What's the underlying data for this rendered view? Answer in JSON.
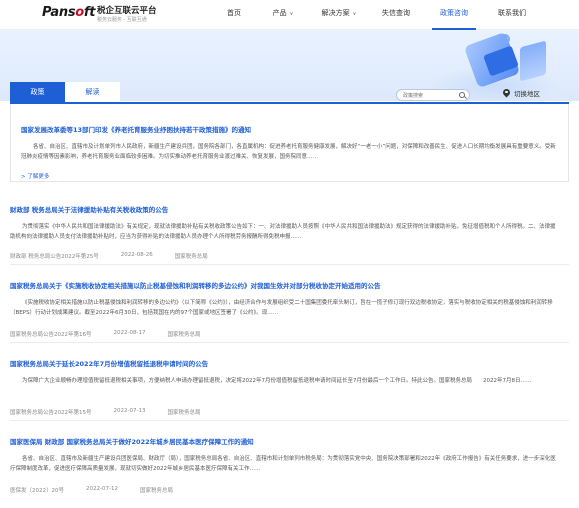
{
  "header": {
    "logo_text_a": "Pans",
    "logo_text_o": "o",
    "logo_text_b": "ft",
    "brand_title": "税企互联云平台",
    "brand_subtitle": "税务云服务 · 互联互通",
    "nav": [
      {
        "label": "首页",
        "has_chevron": false,
        "active": false
      },
      {
        "label": "产品",
        "has_chevron": true,
        "active": false
      },
      {
        "label": "解决方案",
        "has_chevron": true,
        "active": false
      },
      {
        "label": "失信查询",
        "has_chevron": false,
        "active": false
      },
      {
        "label": "政策咨询",
        "has_chevron": false,
        "active": true
      },
      {
        "label": "联系我们",
        "has_chevron": false,
        "active": false
      }
    ],
    "chevron": "∨"
  },
  "tabs": [
    {
      "label": "政策",
      "active": true
    },
    {
      "label": "解读",
      "active": false
    }
  ],
  "search": {
    "placeholder": "政策搜索"
  },
  "region": {
    "label": "切换地区"
  },
  "featured": {
    "title": "国家发展改革委等13部门印发《养老托育服务业纾困扶持若干政策措施》的通知",
    "body": "各省、自治区、直辖市及计划单列市人民政府，新疆生产建设兵团，国务院各部门，各直属机构：促进养老托育服务健康发展，解决好“一老一小”问题，对保障和改善民生、促进人口长期均衡发展具有重要意义。受新冠肺炎疫情等因素影响，养老托育服务业面临较多困难。为切实推动养老托育服务业渡过难关、恢复发展，国务院同意……",
    "more": "了解更多"
  },
  "articles": [
    {
      "title": "财政部 税务总局关于法律援助补贴有关税收政策的公告",
      "body": "为贯彻落实《中华人民共和国法律援助法》有关规定，现就法律援助补贴有关税收政策公告如下：一、对法律援助人员按照《中华人民共和国法律援助法》规定获得的法律援助补贴，免征增值税和个人所得税。二、法律援助机构向法律援助人员支付法律援助补贴时，应当为获得补贴的法律援助人员办理个人所得税劳务报酬所得免税申报……",
      "doc_no": "财政部 税务总局公告2022年第25号",
      "date": "2022-08-26",
      "issuer": "国家税务总局"
    },
    {
      "title": "国家税务总局关于《实施税收协定相关措施以防止税基侵蚀和利润转移的多边公约》对我国生效并对部分税收协定开始适用的公告",
      "body": "《实施税收协定相关措施以防止税基侵蚀和利润转移的多边公约》（以下简称《公约》），由经济合作与发展组织受二十国集团委托牵头制订，旨在一揽子修订现行双边税收协定，落实与税收协定相关的税基侵蚀和利润转移（BEPS）行动计划成果建议。截至2022年6月30日，包括我国在内的97个国家或地区签署了《公约》。现……",
      "doc_no": "国家税务总局公告2022年第16号",
      "date": "2022-08-17",
      "issuer": "国家税务总局"
    },
    {
      "title": "国家税务总局关于延长2022年7月份增值税留抵退税申请时间的公告",
      "body": "为保障广大企业顺畅办理增值税留抵退税相关事项，方便纳税人申请办理留抵退税，决定将2022年7月份增值税留抵退税申请时间延长至7月份最后一个工作日。特此公告。国家税务总局　　2022年7月8日……",
      "doc_no": "国家税务总局公告2022年第15号",
      "date": "2022-07-13",
      "issuer": "国家税务总局"
    },
    {
      "title": "国家医保局 财政部 国家税务总局关于做好2022年城乡居民基本医疗保障工作的通知",
      "body": "各省、自治区、直辖市及新疆生产建设兵团医保局、财政厅（局），国家税务总局各省、自治区、直辖市和计划单列市税务局：为贯彻落实党中央、国务院决策部署和2022年《政府工作报告》有关任务要求，进一步深化医疗保障制度改革，促进医疗保障高质量发展，现就切实做好2022年城乡居民基本医疗保障有关工作……",
      "doc_no": "医保发〔2022〕20号",
      "date": "2022-07-12",
      "issuer": "国家税务总局"
    }
  ],
  "colors": {
    "accent": "#1f5fd6",
    "banner": "#e6efff"
  }
}
